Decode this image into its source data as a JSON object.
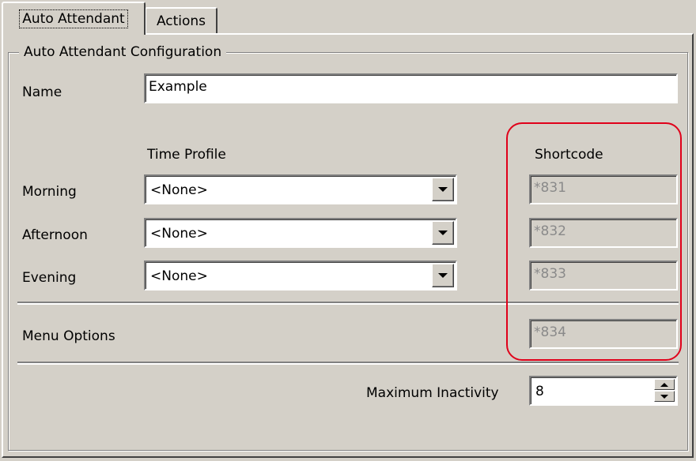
{
  "tabs": [
    {
      "label": "Auto Attendant",
      "active": true
    },
    {
      "label": "Actions",
      "active": false
    }
  ],
  "group": {
    "title": "Auto Attendant Configuration"
  },
  "name": {
    "label": "Name",
    "value": "Example"
  },
  "headers": {
    "time_profile": "Time Profile",
    "shortcode": "Shortcode"
  },
  "rows": [
    {
      "label": "Morning",
      "time_profile": "<None>",
      "shortcode": "*831"
    },
    {
      "label": "Afternoon",
      "time_profile": "<None>",
      "shortcode": "*832"
    },
    {
      "label": "Evening",
      "time_profile": "<None>",
      "shortcode": "*833"
    }
  ],
  "menu_options": {
    "label": "Menu Options",
    "shortcode": "*834"
  },
  "max_inactivity": {
    "label": "Maximum Inactivity",
    "value": "8"
  },
  "colors": {
    "highlight": "#e0001a",
    "window_bg": "#d4d0c8"
  }
}
